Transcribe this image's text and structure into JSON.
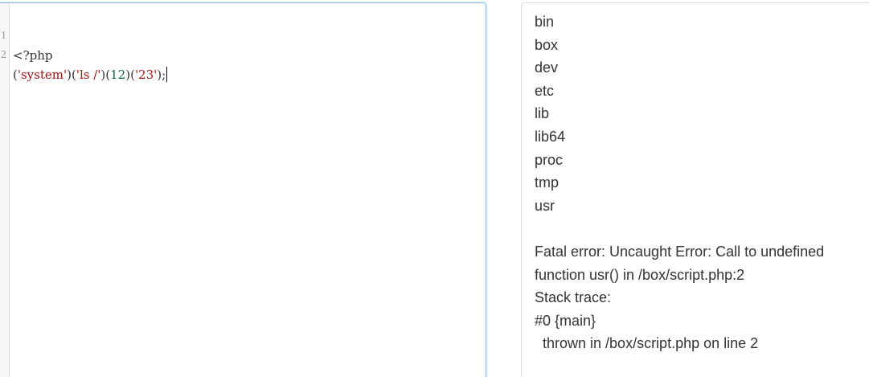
{
  "editor": {
    "lines": [
      {
        "number": "1",
        "tokens": [
          {
            "text": "<?php",
            "kind": "punc"
          }
        ]
      },
      {
        "number": "2",
        "tokens": [
          {
            "text": "(",
            "kind": "punc"
          },
          {
            "text": "'system'",
            "kind": "str"
          },
          {
            "text": ")(",
            "kind": "punc"
          },
          {
            "text": "'ls /'",
            "kind": "str"
          },
          {
            "text": ")(",
            "kind": "punc"
          },
          {
            "text": "12",
            "kind": "num"
          },
          {
            "text": ")(",
            "kind": "punc"
          },
          {
            "text": "'23'",
            "kind": "str"
          },
          {
            "text": ");",
            "kind": "punc"
          }
        ]
      }
    ],
    "colors": {
      "string": "#aa1111",
      "number": "#116644",
      "text": "#333333",
      "line_number": "#999999",
      "focus_border": "#85b7e6"
    }
  },
  "output": {
    "lines": [
      "bin",
      "box",
      "dev",
      "etc",
      "lib",
      "lib64",
      "proc",
      "tmp",
      "usr",
      "",
      "Fatal error: Uncaught Error: Call to undefined",
      "function usr() in /box/script.php:2",
      "Stack trace:",
      "#0 {main}",
      "  thrown in /box/script.php on line 2"
    ]
  }
}
